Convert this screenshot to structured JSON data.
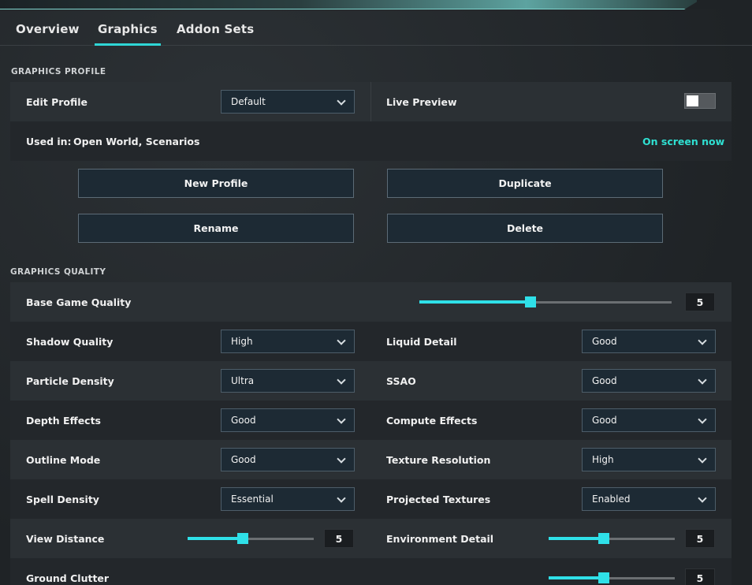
{
  "tabs": [
    {
      "label": "Overview"
    },
    {
      "label": "Graphics"
    },
    {
      "label": "Addon Sets"
    }
  ],
  "profile": {
    "section_title": "GRAPHICS PROFILE",
    "edit_profile_label": "Edit Profile",
    "edit_profile_value": "Default",
    "live_preview_label": "Live Preview",
    "live_preview_on": false,
    "used_in_label": "Used in:",
    "used_in_value": "Open World, Scenarios",
    "status": "On screen now",
    "buttons": {
      "new_profile": "New Profile",
      "duplicate": "Duplicate",
      "rename": "Rename",
      "delete": "Delete"
    }
  },
  "quality": {
    "section_title": "GRAPHICS QUALITY",
    "base": {
      "label": "Base Game Quality",
      "value": "5",
      "fraction": 0.44
    },
    "settings": [
      {
        "left_label": "Shadow Quality",
        "left_value": "High",
        "right_label": "Liquid Detail",
        "right_value": "Good"
      },
      {
        "left_label": "Particle Density",
        "left_value": "Ultra",
        "right_label": "SSAO",
        "right_value": "Good"
      },
      {
        "left_label": "Depth Effects",
        "left_value": "Good",
        "right_label": "Compute Effects",
        "right_value": "Good"
      },
      {
        "left_label": "Outline Mode",
        "left_value": "Good",
        "right_label": "Texture Resolution",
        "right_value": "High"
      },
      {
        "left_label": "Spell Density",
        "left_value": "Essential",
        "right_label": "Projected Textures",
        "right_value": "Enabled"
      }
    ],
    "view_distance": {
      "label": "View Distance",
      "value": "5",
      "fraction": 0.44
    },
    "environment_detail": {
      "label": "Environment Detail",
      "value": "5",
      "fraction": 0.44
    },
    "ground_clutter": {
      "label": "Ground Clutter",
      "value": "5",
      "fraction": 0.44
    }
  },
  "colors": {
    "accent": "#2fe0e8",
    "status": "#2fe0d2",
    "panel": "#272c30"
  }
}
